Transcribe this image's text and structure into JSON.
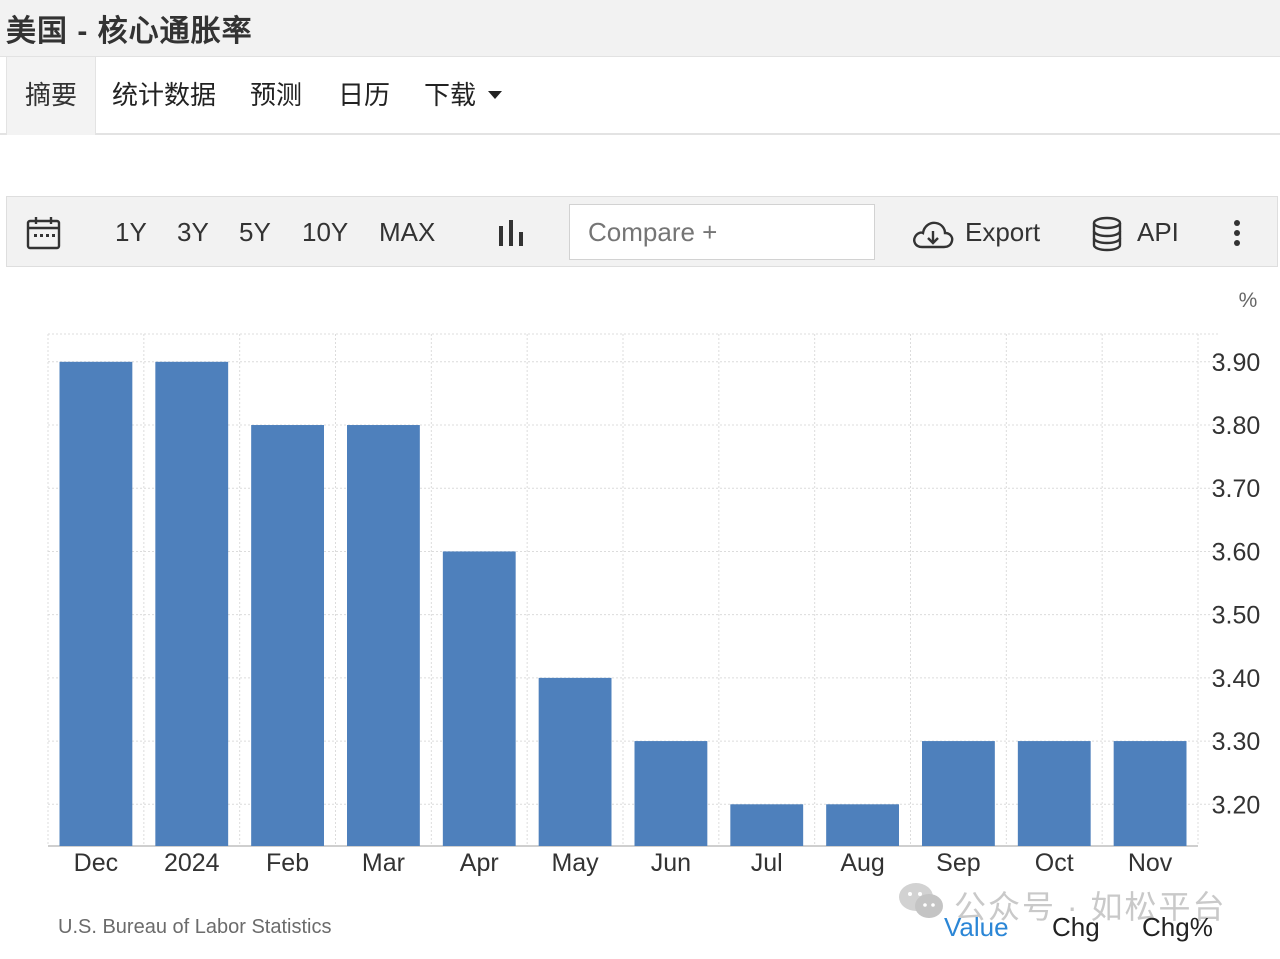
{
  "header": {
    "title": "美国 - 核心通胀率"
  },
  "tabs": [
    {
      "label": "摘要"
    },
    {
      "label": "统计数据"
    },
    {
      "label": "预测"
    },
    {
      "label": "日历"
    },
    {
      "label": "下载"
    }
  ],
  "toolbar": {
    "calendar_icon": "calendar-icon",
    "ranges": [
      "1Y",
      "3Y",
      "5Y",
      "10Y",
      "MAX"
    ],
    "chart_type_icon": "bar-chart-icon",
    "compare_placeholder": "Compare +",
    "export_label": "Export",
    "export_icon": "cloud-download-icon",
    "api_label": "API",
    "api_icon": "database-icon",
    "more_icon": "vertical-ellipsis-icon"
  },
  "chart_data": {
    "type": "bar",
    "unit": "%",
    "categories": [
      "Dec",
      "2024",
      "Feb",
      "Mar",
      "Apr",
      "May",
      "Jun",
      "Jul",
      "Aug",
      "Sep",
      "Oct",
      "Nov"
    ],
    "values": [
      3.9,
      3.9,
      3.8,
      3.8,
      3.6,
      3.4,
      3.3,
      3.2,
      3.2,
      3.3,
      3.3,
      3.3
    ],
    "yticks": [
      "3.20",
      "3.30",
      "3.40",
      "3.50",
      "3.60",
      "3.70",
      "3.80",
      "3.90"
    ],
    "ylim": [
      3.134,
      3.944
    ],
    "yaxis_position": "right",
    "grid": true,
    "bar_color": "#4e80bc"
  },
  "footer": {
    "source": "U.S. Bureau of Labor Statistics",
    "links": [
      "Value",
      "Chg",
      "Chg%"
    ],
    "link_active_color": "#2b86d6"
  },
  "watermark": {
    "text": "公众号 · 如松平台"
  }
}
